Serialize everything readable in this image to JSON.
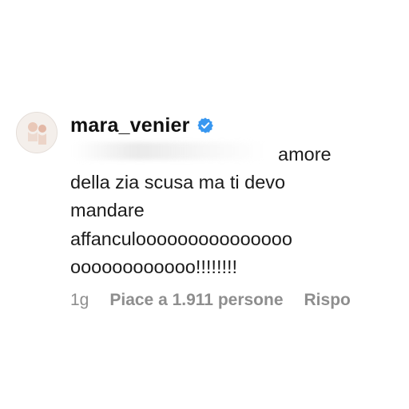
{
  "comment": {
    "username": "mara_venier",
    "verified": true,
    "text_lines": [
      "amore",
      "della zia scusa ma ti devo",
      "mandare",
      "affanculooooooooooooooo",
      "oooooooooooo!!!!!!!!"
    ],
    "time": "1g",
    "likes": "Piace a 1.911 persone",
    "reply": "Rispo"
  },
  "colors": {
    "verified_badge": "#3897f0",
    "meta_text": "#8e8e8e",
    "text": "#1c1c1c"
  },
  "icons": {
    "verified": "verified-badge-icon",
    "avatar": "profile-avatar"
  }
}
